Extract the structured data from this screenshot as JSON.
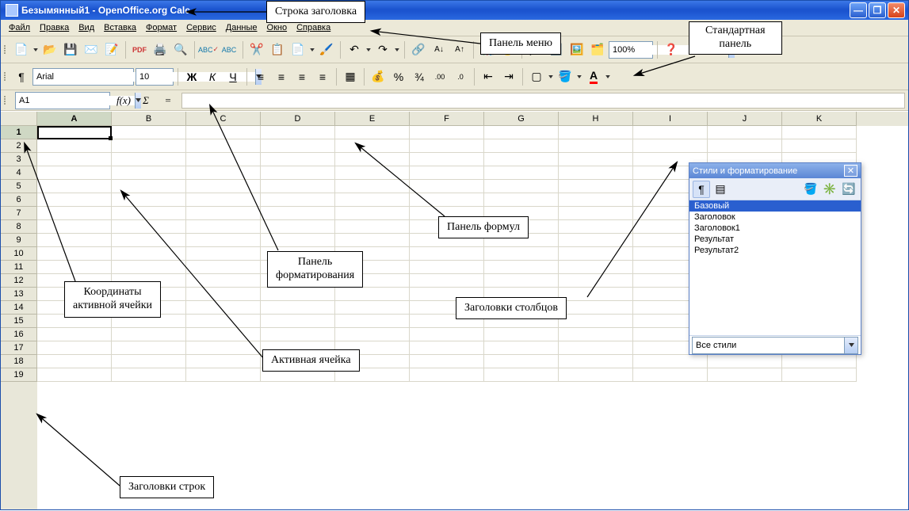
{
  "title": "Безымянный1 - OpenOffice.org Calc",
  "menubar": {
    "file": "Файл",
    "edit": "Правка",
    "view": "Вид",
    "insert": "Вставка",
    "format": "Формат",
    "tools": "Сервис",
    "data": "Данные",
    "window": "Окно",
    "help": "Справка"
  },
  "toolbar_standard": {
    "zoom": "100%"
  },
  "toolbar_format": {
    "font": "Arial",
    "size": "10"
  },
  "formulabar": {
    "cell_ref": "A1",
    "fx": "f(x)",
    "sigma": "Σ",
    "eq": "=",
    "value": ""
  },
  "columns": [
    "A",
    "B",
    "C",
    "D",
    "E",
    "F",
    "G",
    "H",
    "I",
    "J",
    "K"
  ],
  "rows": [
    "1",
    "2",
    "3",
    "4",
    "5",
    "6",
    "7",
    "8",
    "9",
    "10",
    "11",
    "12",
    "13",
    "14",
    "15",
    "16",
    "17",
    "18",
    "19"
  ],
  "styles_panel": {
    "title": "Стили и форматирование",
    "items": [
      "Базовый",
      "Заголовок",
      "Заголовок1",
      "Результат",
      "Результат2"
    ],
    "filter": "Все стили"
  },
  "callouts": {
    "title_row": "Строка заголовка",
    "menu_panel": "Панель меню",
    "standard_panel": "Стандартная\nпанель",
    "coord": "Координаты\nактивной ячейки",
    "format_panel": "Панель\nформатирования",
    "formula_panel": "Панель формул",
    "col_headers": "Заголовки столбцов",
    "active_cell": "Активная ячейка",
    "row_headers": "Заголовки строк"
  }
}
